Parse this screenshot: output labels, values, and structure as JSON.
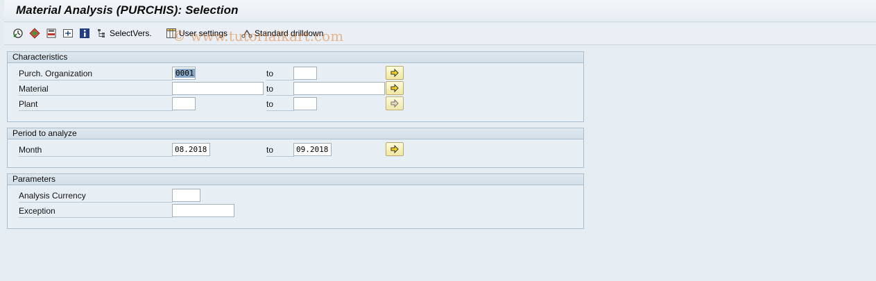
{
  "window": {
    "title": "Material Analysis (PURCHIS): Selection"
  },
  "toolbar": {
    "execute_icon": "execute-icon",
    "execute_print_icon": "execute-print-icon",
    "save_variant_icon": "save-as-variant-icon",
    "select_all_icon": "selection-options-icon",
    "info_icon": "information-icon",
    "select_vers_label": "SelectVers.",
    "user_settings_label": "User settings",
    "standard_drilldown_label": "Standard drilldown"
  },
  "watermark": "© www.tutorialkart.com",
  "characteristics": {
    "title": "Characteristics",
    "to_label": "to",
    "rows": [
      {
        "label": "Purch. Organization",
        "from": "0001",
        "to": ""
      },
      {
        "label": "Material",
        "from": "",
        "to": ""
      },
      {
        "label": "Plant",
        "from": "",
        "to": ""
      }
    ]
  },
  "period": {
    "title": "Period to analyze",
    "to_label": "to",
    "rows": [
      {
        "label": "Month",
        "from": "08.2018",
        "to": "09.2018"
      }
    ]
  },
  "parameters": {
    "title": "Parameters",
    "rows": [
      {
        "label": "Analysis Currency",
        "value": ""
      },
      {
        "label": "Exception",
        "value": ""
      }
    ]
  },
  "colors": {
    "background": "#e6edf2",
    "group_border": "#a9bdcc",
    "arrow_button": "#f6eeb8",
    "selection": "#8aa8c8"
  }
}
